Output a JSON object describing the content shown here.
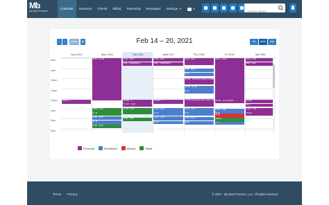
{
  "app": {
    "logo_mark": "Mb",
    "logo_name": "My Best Practice"
  },
  "nav": {
    "items": [
      {
        "label": "Calendar"
      },
      {
        "label": "Sessions"
      },
      {
        "label": "Clients"
      },
      {
        "label": "Billing"
      },
      {
        "label": "Reporting"
      },
      {
        "label": "Messages"
      },
      {
        "label": "Settings"
      }
    ],
    "active": "Calendar",
    "toolbar_icons": [
      "user-icon",
      "clipboard-icon",
      "calendar-icon",
      "document-icon",
      "cloud-icon",
      "help-icon"
    ],
    "alert_icon": "shield-icon"
  },
  "search": {
    "placeholder": "Search clients",
    "value": ""
  },
  "calendar": {
    "title": "Feb 14 – 20, 2021",
    "prev_label": "<",
    "next_label": ">",
    "today_label": "today",
    "views": [
      "list",
      "week",
      "day"
    ],
    "active_view": "week",
    "days": [
      {
        "label": "Sun 2/14",
        "today": false
      },
      {
        "label": "Mon 2/15",
        "today": false
      },
      {
        "label": "Tue 2/16",
        "today": true
      },
      {
        "label": "Wed 2/17",
        "today": false
      },
      {
        "label": "Thu 2/18",
        "today": false
      },
      {
        "label": "Fri 2/19",
        "today": false
      },
      {
        "label": "Sat 2/20",
        "today": false
      }
    ],
    "hours": [
      "8am",
      "9am",
      "10am",
      "11am",
      "12pm",
      "1pm",
      "2pm",
      "3pm"
    ],
    "events": [
      {
        "day": 1,
        "start": 8.0,
        "end": 12.2,
        "type": "personal",
        "text": "8:00 - 12:00"
      },
      {
        "day": 1,
        "start": 12.95,
        "end": 13.35,
        "type": "billed",
        "text": "1:00 - 1:30"
      },
      {
        "day": 1,
        "start": 13.4,
        "end": 13.75,
        "type": "billed",
        "text": "R_B"
      },
      {
        "day": 1,
        "start": 13.8,
        "end": 14.15,
        "type": "scheduled",
        "text": "1:50 - 2:20"
      },
      {
        "day": 1,
        "start": 14.2,
        "end": 14.6,
        "type": "scheduled",
        "text": "R_B"
      },
      {
        "day": 1,
        "start": 14.65,
        "end": 15.0,
        "type": "billed",
        "text": "2:45 - 3:15"
      },
      {
        "day": 2,
        "start": 8.0,
        "end": 8.35,
        "type": "personal",
        "text": "8:00 - 9:00"
      },
      {
        "day": 2,
        "start": 8.4,
        "end": 8.75,
        "type": "personal",
        "text": "Mtg - Cafe/Bakery"
      },
      {
        "day": 2,
        "start": 12.15,
        "end": 12.5,
        "type": "personal",
        "text": "12:00 - 1"
      },
      {
        "day": 2,
        "start": 12.5,
        "end": 12.85,
        "type": "personal",
        "text": "12:30 - Todd"
      },
      {
        "day": 2,
        "start": 12.95,
        "end": 13.6,
        "type": "billed",
        "text": "1:00 - 1:45"
      },
      {
        "day": 2,
        "start": 13.95,
        "end": 14.3,
        "type": "billed",
        "text": "1:50 - 2:50"
      },
      {
        "day": 3,
        "start": 8.0,
        "end": 8.35,
        "type": "personal",
        "text": "8:00 - 8:30"
      },
      {
        "day": 3,
        "start": 8.4,
        "end": 8.75,
        "type": "personal",
        "text": "Mtg - Cafe/Bakery"
      },
      {
        "day": 3,
        "start": 12.15,
        "end": 12.55,
        "type": "personal",
        "text": "12:00 - 1"
      },
      {
        "day": 3,
        "start": 12.95,
        "end": 13.35,
        "type": "scheduled",
        "text": "1:00 - 1:30"
      },
      {
        "day": 3,
        "start": 13.4,
        "end": 13.75,
        "type": "scheduled",
        "text": "R_B"
      },
      {
        "day": 3,
        "start": 13.8,
        "end": 14.2,
        "type": "scheduled",
        "text": "2:00 - 2:30"
      },
      {
        "day": 3,
        "start": 14.25,
        "end": 14.55,
        "type": "scheduled",
        "text": "R_B"
      },
      {
        "day": 4,
        "start": 8.0,
        "end": 8.7,
        "type": "personal",
        "text": "8:00 - 9:00"
      },
      {
        "day": 4,
        "start": 9.0,
        "end": 9.4,
        "type": "scheduled",
        "text": "9:00 - 9:30"
      },
      {
        "day": 4,
        "start": 9.45,
        "end": 9.8,
        "type": "scheduled",
        "text": "R_B"
      },
      {
        "day": 4,
        "start": 10.0,
        "end": 10.6,
        "type": "personal",
        "text": "10:00 - Submit Program to MBP"
      },
      {
        "day": 4,
        "start": 10.75,
        "end": 11.2,
        "type": "scheduled",
        "text": "10:50 - 11:30"
      },
      {
        "day": 4,
        "start": 11.2,
        "end": 11.55,
        "type": "scheduled",
        "text": "R_B"
      },
      {
        "day": 4,
        "start": 12.05,
        "end": 12.85,
        "type": "personal",
        "text": "*NPMN Meeting with Smith and Jones"
      },
      {
        "day": 4,
        "start": 12.95,
        "end": 13.35,
        "type": "scheduled",
        "text": "1:00 - 1:30"
      },
      {
        "day": 4,
        "start": 13.4,
        "end": 13.75,
        "type": "scheduled",
        "text": "R_B"
      },
      {
        "day": 4,
        "start": 13.85,
        "end": 14.2,
        "type": "scheduled",
        "text": "1:50 - 2:20"
      },
      {
        "day": 4,
        "start": 14.25,
        "end": 14.6,
        "type": "scheduled",
        "text": "R_B"
      },
      {
        "day": 5,
        "start": 8.0,
        "end": 12.2,
        "type": "personal",
        "text": "8:00 - 12:00"
      },
      {
        "day": 5,
        "start": 12.15,
        "end": 12.5,
        "type": "personal",
        "text": "12:00 - Lunch/Rest"
      },
      {
        "day": 5,
        "start": 13.0,
        "end": 13.35,
        "type": "scheduled",
        "text": "1:00 - 1:30"
      },
      {
        "day": 5,
        "start": 13.4,
        "end": 13.75,
        "type": "scheduled",
        "text": "R_B"
      },
      {
        "day": 5,
        "start": 13.85,
        "end": 14.2,
        "type": "scheduled",
        "text": "1:50 - 2:20"
      },
      {
        "day": 5,
        "start": 14.25,
        "end": 14.6,
        "type": "scheduled",
        "text": "R_B"
      },
      {
        "day": 5,
        "start": 13.55,
        "end": 13.95,
        "type": "missed",
        "text": "1:40"
      },
      {
        "day": 5,
        "start": 13.95,
        "end": 14.35,
        "type": "billed",
        "text": "Hadeo"
      },
      {
        "day": 6,
        "start": 8.0,
        "end": 8.35,
        "type": "personal",
        "text": "8:00 - 9:00"
      },
      {
        "day": 6,
        "start": 8.4,
        "end": 8.75,
        "type": "personal",
        "text": "Mtg - Cafe"
      },
      {
        "day": 6,
        "start": 12.15,
        "end": 12.5,
        "type": "personal",
        "text": "12:00"
      },
      {
        "day": 6,
        "start": 12.55,
        "end": 12.85,
        "type": "personal",
        "text": "Pt-1"
      },
      {
        "day": 6,
        "start": 12.95,
        "end": 13.35,
        "type": "personal",
        "text": "1:00 - 1:30"
      },
      {
        "day": 6,
        "start": 13.4,
        "end": 13.7,
        "type": "personal",
        "text": "*Shed"
      },
      {
        "day": 0,
        "start": 12.15,
        "end": 12.55,
        "type": "personal",
        "text": "12:00 - 1"
      }
    ],
    "colors": {
      "personal": "#8e2f95",
      "scheduled": "#4d7fca",
      "missed": "#d9303b",
      "billed": "#2f8d3b"
    }
  },
  "legend": [
    {
      "label": "Personal",
      "type": "personal"
    },
    {
      "label": "Scheduled",
      "type": "scheduled"
    },
    {
      "label": "Missed",
      "type": "missed"
    },
    {
      "label": "Billed",
      "type": "billed"
    }
  ],
  "footer": {
    "terms": "Terms",
    "privacy": "Privacy",
    "copyright": "© 2021 - My Best Practice, LLC. All rights reserved."
  }
}
